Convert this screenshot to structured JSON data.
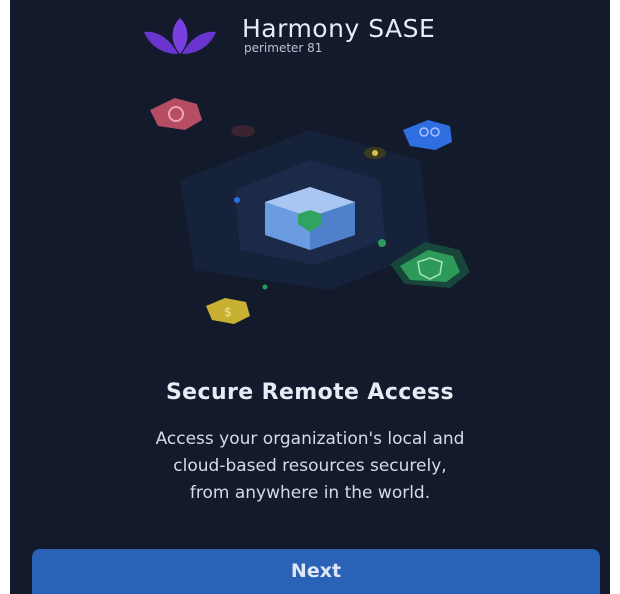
{
  "brand": {
    "title": "Harmony SASE",
    "subtitle": "perimeter 81"
  },
  "hero": {
    "icons": [
      {
        "name": "location-hex-icon",
        "color": "#c9536a"
      },
      {
        "name": "users-hex-icon",
        "color": "#2f6ee0"
      },
      {
        "name": "shield-hex-icon",
        "color": "#2e9a5a"
      },
      {
        "name": "dollar-hex-icon",
        "color": "#c7b032"
      },
      {
        "name": "secure-box-icon",
        "color": "#5d8fd6"
      }
    ]
  },
  "onboarding": {
    "headline": "Secure Remote Access",
    "description_lines": [
      "Access your organization's local and",
      "cloud-based resources securely,",
      "from anywhere in the world."
    ]
  },
  "actions": {
    "next_label": "Next"
  },
  "colors": {
    "background": "#121a2c",
    "accent": "#2a62b8",
    "logo": "#6e3ad6"
  }
}
